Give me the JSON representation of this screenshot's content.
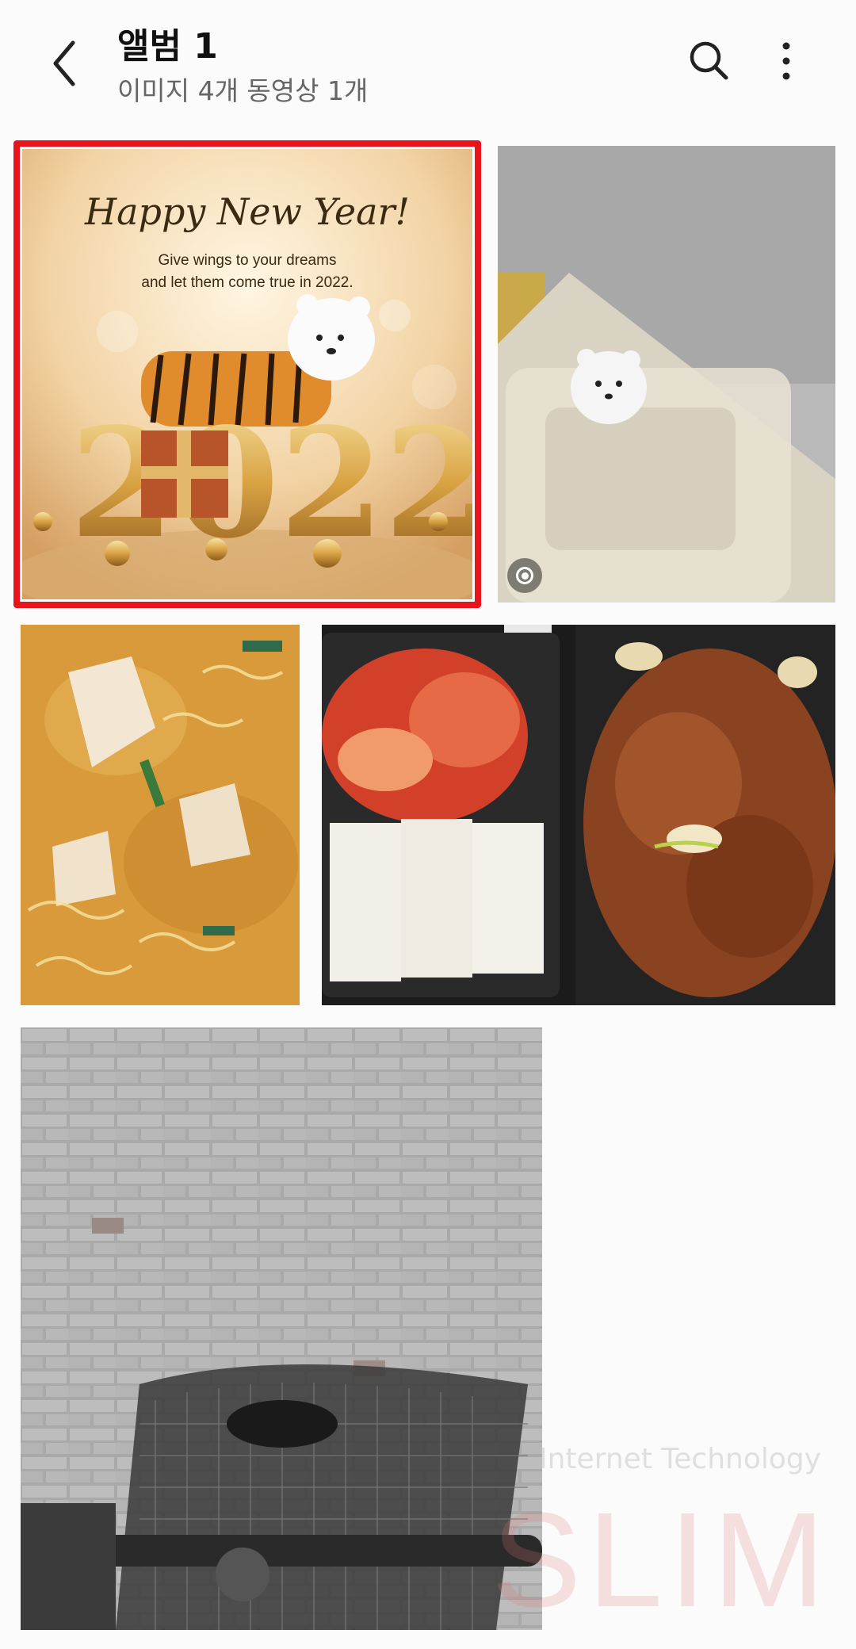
{
  "header": {
    "title": "앨범 1",
    "subtitle": "이미지 4개 동영상 1개",
    "back_icon": "chevron-left-icon",
    "search_icon": "search-icon",
    "more_icon": "more-vertical-icon"
  },
  "tiles": [
    {
      "kind": "image",
      "selected": true,
      "card": {
        "headline": "Happy New Year!",
        "line1": "Give wings to your dreams",
        "line2": "and let them come true in 2022.",
        "numerals": "2022"
      }
    },
    {
      "kind": "video",
      "badge_icon": "video-record-icon"
    },
    {
      "kind": "image"
    },
    {
      "kind": "image"
    },
    {
      "kind": "image"
    }
  ],
  "watermark": {
    "line1": "Internet Technology",
    "line2": "SLIM"
  },
  "colors": {
    "selection_border": "#e8141b",
    "background": "#fbfbfb"
  }
}
